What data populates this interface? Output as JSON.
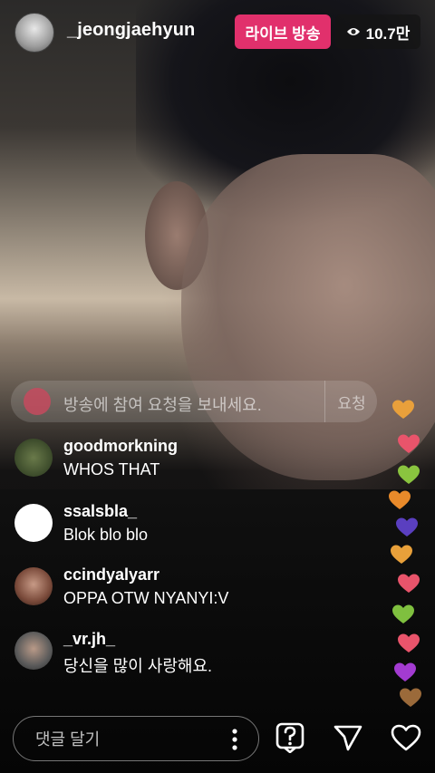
{
  "header": {
    "username": "_jeongjaehyun",
    "live_badge": "라이브 방송",
    "viewer_count": "10.7만",
    "icons": {
      "avatar": "profile-avatar",
      "viewers": "eye-icon"
    }
  },
  "request_bar": {
    "text": "방송에 참여 요청을 보내세요.",
    "button": "요청"
  },
  "comments": [
    {
      "username": "goodmorkning",
      "text": "WHOS THAT"
    },
    {
      "username": "ssalsbla_",
      "text": "Blok blo blo"
    },
    {
      "username": "ccindyalyarr",
      "text": "OPPA OTW NYANYI:V"
    },
    {
      "username": "_vr.jh_",
      "text": "당신을 많이 사랑해요."
    }
  ],
  "hearts_colors": [
    "#e9a03b",
    "#e9546b",
    "#8ac43f",
    "#e98a2a",
    "#5a3fc0",
    "#e8a03a",
    "#e9546b",
    "#7fc03f",
    "#e9546b",
    "#a33bd1",
    "#9b6a3a"
  ],
  "bottom_bar": {
    "comment_placeholder": "댓글 달기",
    "icons": [
      "more-vertical-icon",
      "question-icon",
      "send-icon",
      "heart-icon"
    ]
  },
  "colors": {
    "live_badge": "#e1306c"
  }
}
